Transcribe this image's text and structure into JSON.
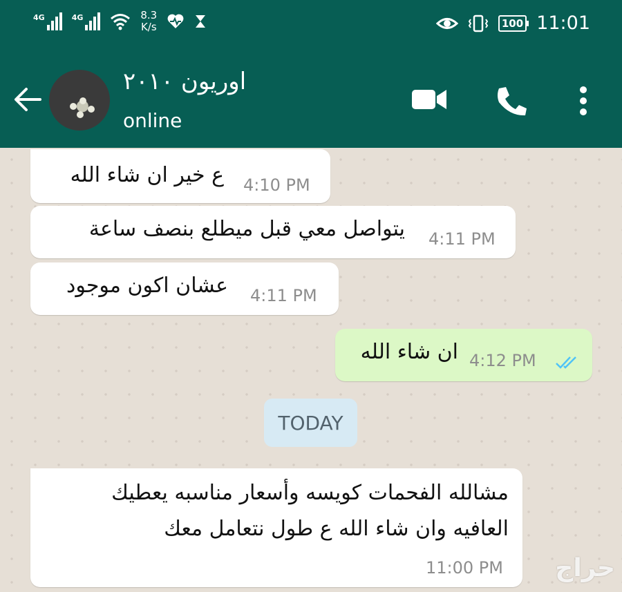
{
  "status_bar": {
    "network1": "4G",
    "network2": "4G",
    "speed_value": "8.3",
    "speed_unit": "K/s",
    "battery": "100",
    "time": "11:01"
  },
  "header": {
    "contact_name": "اوريون ٢٠١٠",
    "status": "online"
  },
  "messages": [
    {
      "direction": "incoming",
      "text": "ع خير ان شاء الله",
      "time": "4:10 PM"
    },
    {
      "direction": "incoming",
      "text": "يتواصل معي قبل ميطلع بنصف ساعة",
      "time": "4:11 PM"
    },
    {
      "direction": "incoming",
      "text": "عشان اكون موجود",
      "time": "4:11 PM"
    },
    {
      "direction": "outgoing",
      "text": "ان شاء الله",
      "time": "4:12 PM",
      "read": true
    },
    {
      "direction": "incoming",
      "text_line1": "مشالله الفحمات كويسه وأسعار مناسبه يعطيك",
      "text_line2": "العافيه وان شاء الله ع طول نتعامل معك",
      "time": "11:00 PM"
    }
  ],
  "date_divider": "TODAY",
  "watermark": "حراج",
  "colors": {
    "header": "#075e54",
    "outgoing_bubble": "#dcf8c6",
    "incoming_bubble": "#ffffff",
    "read_ticks": "#4fc3f7",
    "date_chip": "#d7eaf4"
  }
}
